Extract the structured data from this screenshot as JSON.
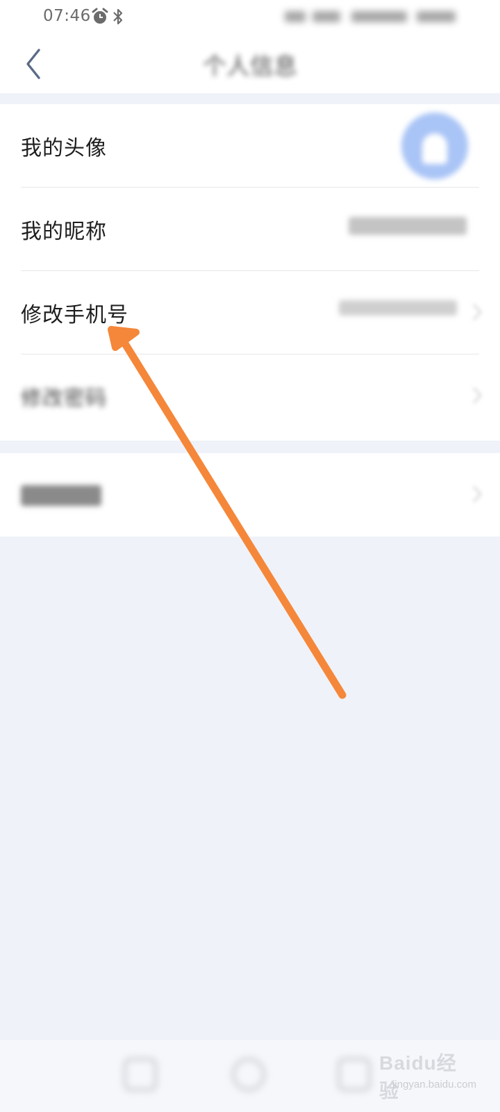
{
  "status_bar": {
    "time": "07:46",
    "icons": [
      "alarm-icon",
      "bluetooth-icon"
    ]
  },
  "nav": {
    "title": "个人信息",
    "back_icon": "chevron-left-icon"
  },
  "list": {
    "rows": [
      {
        "label": "我的头像",
        "value": ""
      },
      {
        "label": "我的昵称",
        "value": ""
      },
      {
        "label": "修改手机号",
        "value": ""
      },
      {
        "label": "修改密码",
        "value": ""
      }
    ],
    "section2_rows": [
      {
        "label": ""
      }
    ]
  },
  "annotation": {
    "color": "#f5873a",
    "target": "修改手机号"
  },
  "watermark": {
    "logo": "Baidu经验",
    "sub": "jingyan.baidu.com"
  },
  "colors": {
    "page_bg": "#eff2f8",
    "card_bg": "#ffffff",
    "avatar": "#a9c4f6"
  }
}
